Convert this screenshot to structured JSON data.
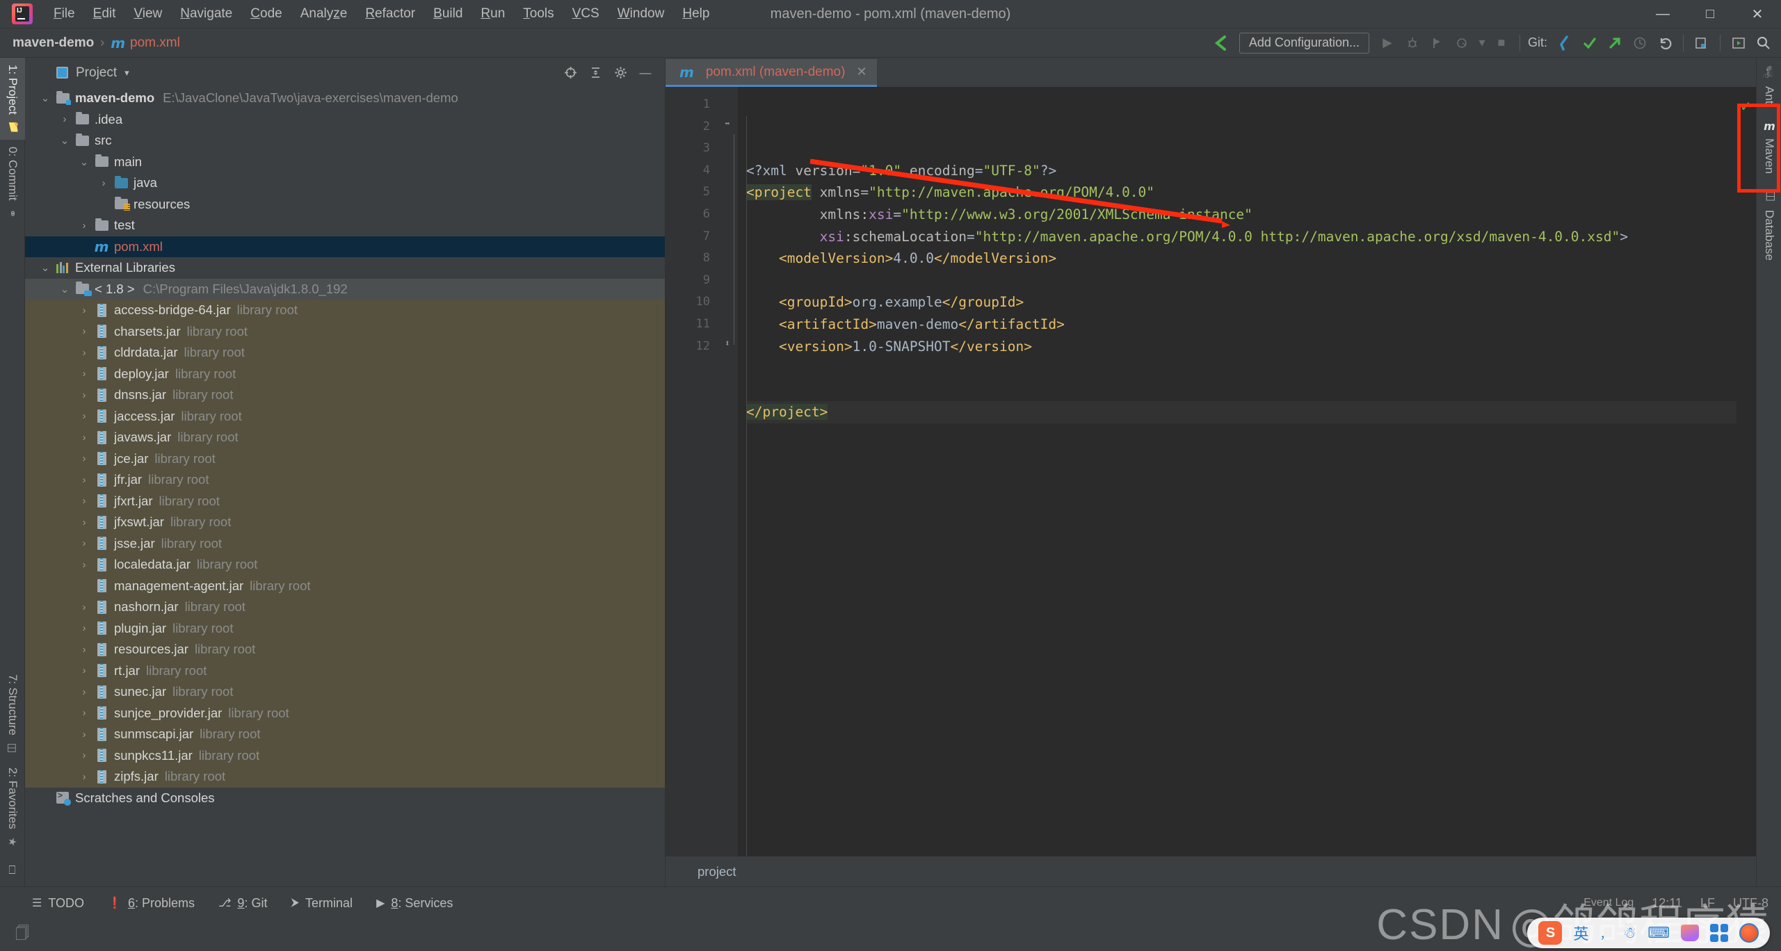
{
  "window": {
    "title": "maven-demo - pom.xml (maven-demo)",
    "logo_icon": "intellij-idea-logo",
    "minimize_icon": "minimize-icon",
    "maximize_icon": "maximize-icon",
    "close_icon": "close-icon"
  },
  "menu": {
    "items": [
      {
        "label": "File",
        "mnemonic": "F"
      },
      {
        "label": "Edit",
        "mnemonic": "E"
      },
      {
        "label": "View",
        "mnemonic": "V"
      },
      {
        "label": "Navigate",
        "mnemonic": "N"
      },
      {
        "label": "Code",
        "mnemonic": "C"
      },
      {
        "label": "Analyze",
        "mnemonic": "z"
      },
      {
        "label": "Refactor",
        "mnemonic": "R"
      },
      {
        "label": "Build",
        "mnemonic": "B"
      },
      {
        "label": "Run",
        "mnemonic": "R"
      },
      {
        "label": "Tools",
        "mnemonic": "T"
      },
      {
        "label": "VCS",
        "mnemonic": "V"
      },
      {
        "label": "Window",
        "mnemonic": "W"
      },
      {
        "label": "Help",
        "mnemonic": "H"
      }
    ]
  },
  "navbar": {
    "breadcrumb": {
      "project": "maven-demo",
      "separator": "›",
      "file_icon": "maven-m-icon",
      "file": "pom.xml"
    },
    "toolbar": {
      "back_arrow_icon": "green-arrow-icon",
      "add_configuration_label": "Add Configuration...",
      "run_icon": "run-icon",
      "debug_icon": "debug-icon",
      "run_coverage_icon": "run-with-coverage-icon",
      "profiler_icon": "profiler-icon",
      "profiler_dropdown_icon": "chevron-down-icon",
      "stop_icon": "stop-icon",
      "git_label": "Git:",
      "git_update_icon": "update-project-icon",
      "git_commit_icon": "commit-icon",
      "git_push_icon": "push-icon",
      "git_history_icon": "history-icon",
      "git_rollback_icon": "rollback-icon",
      "structure_icon": "search-everywhere-structure-icon",
      "preview_icon": "preview-icon",
      "search_icon": "search-icon"
    }
  },
  "left_stripe": {
    "tabs": [
      {
        "label": "1: Project",
        "icon": "project-folder-icon",
        "selected": true
      },
      {
        "label": "0: Commit",
        "icon": "commit-icon",
        "selected": false
      },
      {
        "label": "7: Structure",
        "icon": "structure-icon",
        "selected": false
      },
      {
        "label": "2: Favorites",
        "icon": "star-icon",
        "selected": false
      }
    ],
    "bottom_icon": "terminal-window-icon"
  },
  "right_stripe": {
    "tabs": [
      {
        "label": "Ant",
        "icon": "ant-bug-icon",
        "highlighted": false
      },
      {
        "label": "Maven",
        "icon": "maven-m-icon",
        "highlighted": true
      },
      {
        "label": "Database",
        "icon": "database-icon",
        "highlighted": false
      }
    ],
    "highlight_color": "#fc2b10"
  },
  "project_panel": {
    "title": "Project",
    "title_icon": "project-view-icon",
    "caret_icon": "chevron-down-icon",
    "actions": [
      {
        "name": "locate-icon",
        "glyph": "⊕"
      },
      {
        "name": "collapse-all-icon",
        "glyph": "⩥"
      },
      {
        "name": "settings-gear-icon",
        "glyph": "⚙"
      },
      {
        "name": "hide-icon",
        "glyph": "−"
      }
    ],
    "tree": [
      {
        "label": "maven-demo",
        "hint": "E:\\JavaClone\\JavaTwo\\java-exercises\\maven-demo",
        "indent": 0,
        "arrow": "expanded",
        "icon": "module-folder-icon",
        "bold": true,
        "style": "normal"
      },
      {
        "label": ".idea",
        "hint": "",
        "indent": 1,
        "arrow": "collapsed",
        "icon": "folder-icon",
        "bold": false,
        "style": "normal"
      },
      {
        "label": "src",
        "hint": "",
        "indent": 1,
        "arrow": "expanded",
        "icon": "folder-icon",
        "bold": false,
        "style": "normal"
      },
      {
        "label": "main",
        "hint": "",
        "indent": 2,
        "arrow": "expanded",
        "icon": "folder-icon",
        "bold": false,
        "style": "normal"
      },
      {
        "label": "java",
        "hint": "",
        "indent": 3,
        "arrow": "collapsed",
        "icon": "source-folder-icon",
        "bold": false,
        "style": "normal"
      },
      {
        "label": "resources",
        "hint": "",
        "indent": 3,
        "arrow": "none",
        "icon": "resources-folder-icon",
        "bold": false,
        "style": "normal"
      },
      {
        "label": "test",
        "hint": "",
        "indent": 2,
        "arrow": "collapsed",
        "icon": "folder-icon",
        "bold": false,
        "style": "normal"
      },
      {
        "label": "pom.xml",
        "hint": "",
        "indent": 2,
        "arrow": "none",
        "icon": "maven-m-icon",
        "bold": false,
        "style": "selected"
      },
      {
        "label": "External Libraries",
        "hint": "",
        "indent": 0,
        "arrow": "expanded",
        "icon": "libraries-icon",
        "bold": false,
        "style": "normal"
      },
      {
        "label": "< 1.8 >",
        "hint": "C:\\Program Files\\Java\\jdk1.8.0_192",
        "indent": 1,
        "arrow": "expanded",
        "icon": "jdk-folder-icon",
        "bold": false,
        "style": "lib-header"
      },
      {
        "label": "access-bridge-64.jar",
        "hint": "library root",
        "indent": 2,
        "arrow": "collapsed",
        "icon": "jar-icon",
        "bold": false,
        "style": "lib"
      },
      {
        "label": "charsets.jar",
        "hint": "library root",
        "indent": 2,
        "arrow": "collapsed",
        "icon": "jar-icon",
        "bold": false,
        "style": "lib"
      },
      {
        "label": "cldrdata.jar",
        "hint": "library root",
        "indent": 2,
        "arrow": "collapsed",
        "icon": "jar-icon",
        "bold": false,
        "style": "lib"
      },
      {
        "label": "deploy.jar",
        "hint": "library root",
        "indent": 2,
        "arrow": "collapsed",
        "icon": "jar-icon",
        "bold": false,
        "style": "lib"
      },
      {
        "label": "dnsns.jar",
        "hint": "library root",
        "indent": 2,
        "arrow": "collapsed",
        "icon": "jar-icon",
        "bold": false,
        "style": "lib"
      },
      {
        "label": "jaccess.jar",
        "hint": "library root",
        "indent": 2,
        "arrow": "collapsed",
        "icon": "jar-icon",
        "bold": false,
        "style": "lib"
      },
      {
        "label": "javaws.jar",
        "hint": "library root",
        "indent": 2,
        "arrow": "collapsed",
        "icon": "jar-icon",
        "bold": false,
        "style": "lib"
      },
      {
        "label": "jce.jar",
        "hint": "library root",
        "indent": 2,
        "arrow": "collapsed",
        "icon": "jar-icon",
        "bold": false,
        "style": "lib"
      },
      {
        "label": "jfr.jar",
        "hint": "library root",
        "indent": 2,
        "arrow": "collapsed",
        "icon": "jar-icon",
        "bold": false,
        "style": "lib"
      },
      {
        "label": "jfxrt.jar",
        "hint": "library root",
        "indent": 2,
        "arrow": "collapsed",
        "icon": "jar-icon",
        "bold": false,
        "style": "lib"
      },
      {
        "label": "jfxswt.jar",
        "hint": "library root",
        "indent": 2,
        "arrow": "collapsed",
        "icon": "jar-icon",
        "bold": false,
        "style": "lib"
      },
      {
        "label": "jsse.jar",
        "hint": "library root",
        "indent": 2,
        "arrow": "collapsed",
        "icon": "jar-icon",
        "bold": false,
        "style": "lib"
      },
      {
        "label": "localedata.jar",
        "hint": "library root",
        "indent": 2,
        "arrow": "collapsed",
        "icon": "jar-icon",
        "bold": false,
        "style": "lib"
      },
      {
        "label": "management-agent.jar",
        "hint": "library root",
        "indent": 2,
        "arrow": "none",
        "icon": "jar-icon",
        "bold": false,
        "style": "lib"
      },
      {
        "label": "nashorn.jar",
        "hint": "library root",
        "indent": 2,
        "arrow": "collapsed",
        "icon": "jar-icon",
        "bold": false,
        "style": "lib"
      },
      {
        "label": "plugin.jar",
        "hint": "library root",
        "indent": 2,
        "arrow": "collapsed",
        "icon": "jar-icon",
        "bold": false,
        "style": "lib"
      },
      {
        "label": "resources.jar",
        "hint": "library root",
        "indent": 2,
        "arrow": "collapsed",
        "icon": "jar-icon",
        "bold": false,
        "style": "lib"
      },
      {
        "label": "rt.jar",
        "hint": "library root",
        "indent": 2,
        "arrow": "collapsed",
        "icon": "jar-icon",
        "bold": false,
        "style": "lib"
      },
      {
        "label": "sunec.jar",
        "hint": "library root",
        "indent": 2,
        "arrow": "collapsed",
        "icon": "jar-icon",
        "bold": false,
        "style": "lib"
      },
      {
        "label": "sunjce_provider.jar",
        "hint": "library root",
        "indent": 2,
        "arrow": "collapsed",
        "icon": "jar-icon",
        "bold": false,
        "style": "lib"
      },
      {
        "label": "sunmscapi.jar",
        "hint": "library root",
        "indent": 2,
        "arrow": "collapsed",
        "icon": "jar-icon",
        "bold": false,
        "style": "lib"
      },
      {
        "label": "sunpkcs11.jar",
        "hint": "library root",
        "indent": 2,
        "arrow": "collapsed",
        "icon": "jar-icon",
        "bold": false,
        "style": "lib"
      },
      {
        "label": "zipfs.jar",
        "hint": "library root",
        "indent": 2,
        "arrow": "collapsed",
        "icon": "jar-icon",
        "bold": false,
        "style": "lib"
      },
      {
        "label": "Scratches and Consoles",
        "hint": "",
        "indent": 0,
        "arrow": "none",
        "icon": "scratches-icon",
        "bold": false,
        "style": "normal"
      }
    ]
  },
  "editor": {
    "tab": {
      "label": "pom.xml (maven-demo)",
      "icon": "maven-m-icon",
      "close_icon": "close-icon"
    },
    "inspection_status_icon": "inspections-ok-icon",
    "breadcrumb": "project",
    "line_count": 12,
    "lines": [
      {
        "n": 1,
        "segments": [
          {
            "t": "<?xml ",
            "c": "txt"
          },
          {
            "t": "version",
            "c": "attr"
          },
          {
            "t": "=",
            "c": "txt"
          },
          {
            "t": "\"1.0\"",
            "c": "val"
          },
          {
            "t": " encoding",
            "c": "attr"
          },
          {
            "t": "=",
            "c": "txt"
          },
          {
            "t": "\"UTF-8\"",
            "c": "val"
          },
          {
            "t": "?>",
            "c": "txt"
          }
        ],
        "indent": 0,
        "fold": "none"
      },
      {
        "n": 2,
        "segments": [
          {
            "t": "<project",
            "c": "tag hl"
          },
          {
            "t": " xmlns",
            "c": "attr"
          },
          {
            "t": "=",
            "c": "txt"
          },
          {
            "t": "\"http://maven.apache.org/POM/4.0.0\"",
            "c": "val"
          }
        ],
        "indent": 0,
        "fold": "open"
      },
      {
        "n": 3,
        "segments": [
          {
            "t": "         xmlns:",
            "c": "attr"
          },
          {
            "t": "xsi",
            "c": "ns"
          },
          {
            "t": "=",
            "c": "txt"
          },
          {
            "t": "\"http://www.w3.org/2001/XMLSchema-instance\"",
            "c": "val"
          }
        ],
        "indent": 0,
        "fold": "none"
      },
      {
        "n": 4,
        "segments": [
          {
            "t": "         ",
            "c": "txt"
          },
          {
            "t": "xsi",
            "c": "ns"
          },
          {
            "t": ":schemaLocation",
            "c": "attr"
          },
          {
            "t": "=",
            "c": "txt"
          },
          {
            "t": "\"http://maven.apache.org/POM/4.0.0 http://maven.apache.org/xsd/maven-4.0.0.xsd\"",
            "c": "val"
          },
          {
            "t": ">",
            "c": "txt"
          }
        ],
        "indent": 0,
        "fold": "none"
      },
      {
        "n": 5,
        "segments": [
          {
            "t": "    ",
            "c": "txt"
          },
          {
            "t": "<modelVersion>",
            "c": "tag"
          },
          {
            "t": "4.0.0",
            "c": "txt"
          },
          {
            "t": "</modelVersion>",
            "c": "tag"
          }
        ],
        "indent": 1,
        "fold": "none"
      },
      {
        "n": 6,
        "segments": [],
        "indent": 1,
        "fold": "none"
      },
      {
        "n": 7,
        "segments": [
          {
            "t": "    ",
            "c": "txt"
          },
          {
            "t": "<groupId>",
            "c": "tag"
          },
          {
            "t": "org.example",
            "c": "txt"
          },
          {
            "t": "</groupId>",
            "c": "tag"
          }
        ],
        "indent": 1,
        "fold": "none"
      },
      {
        "n": 8,
        "segments": [
          {
            "t": "    ",
            "c": "txt"
          },
          {
            "t": "<artifactId>",
            "c": "tag"
          },
          {
            "t": "maven-demo",
            "c": "txt"
          },
          {
            "t": "</artifactId>",
            "c": "tag"
          }
        ],
        "indent": 1,
        "fold": "none"
      },
      {
        "n": 9,
        "segments": [
          {
            "t": "    ",
            "c": "txt"
          },
          {
            "t": "<version>",
            "c": "tag"
          },
          {
            "t": "1.0-SNAPSHOT",
            "c": "txt"
          },
          {
            "t": "</version>",
            "c": "tag"
          }
        ],
        "indent": 1,
        "fold": "none"
      },
      {
        "n": 10,
        "segments": [],
        "indent": 1,
        "fold": "none"
      },
      {
        "n": 11,
        "segments": [],
        "indent": 1,
        "fold": "none"
      },
      {
        "n": 12,
        "segments": [
          {
            "t": "</project>",
            "c": "tag hl"
          }
        ],
        "indent": 0,
        "fold": "close",
        "current": true
      }
    ]
  },
  "statusbar": {
    "items": [
      {
        "label": "TODO",
        "icon": "todo-list-icon",
        "mnemonic": ""
      },
      {
        "label": "6: Problems",
        "icon": "problems-icon",
        "mnemonic": "6"
      },
      {
        "label": "9: Git",
        "icon": "git-branch-icon",
        "mnemonic": "9"
      },
      {
        "label": "Terminal",
        "icon": "terminal-icon",
        "mnemonic": ""
      },
      {
        "label": "8: Services",
        "icon": "services-icon",
        "mnemonic": "8"
      }
    ],
    "right": {
      "event_log": "Event Log",
      "caret_position": "12:11",
      "line_separator": "LF",
      "encoding": "UTF-8"
    },
    "tray_icon": "copy-window-icon"
  },
  "watermark": {
    "brand": "CSDN",
    "user": "@鸽鸽程序猿"
  },
  "ime": {
    "logo": "sogou-ime-logo",
    "mode_label": "英",
    "punctuation_label": "，",
    "mic_icon": "microphone-icon",
    "keyboard_icon": "keyboard-icon",
    "skin_icon": "skin-icon",
    "apps_icon": "apps-grid-icon",
    "avatar_icon": "ime-avatar-icon"
  },
  "annotation": {
    "arrow_color": "#fc2b10",
    "arrow_name": "red-pointer-arrow"
  }
}
